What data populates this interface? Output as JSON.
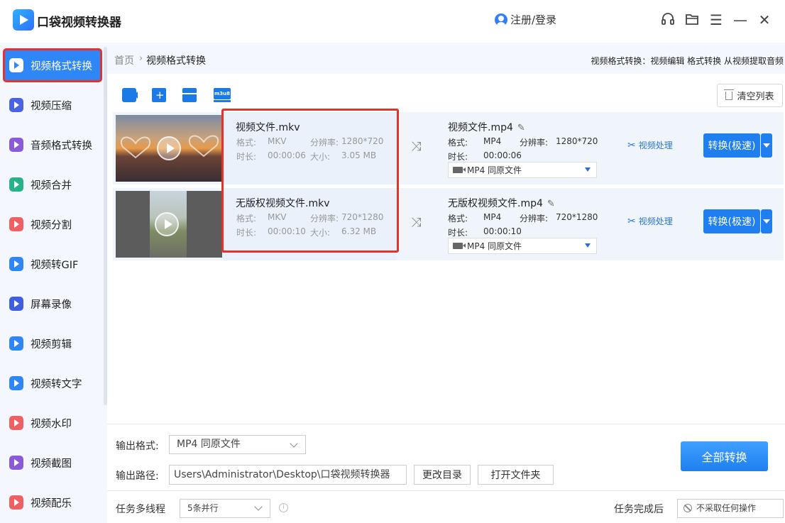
{
  "app": {
    "title": "口袋视频转换器",
    "login": "注册/登录"
  },
  "window": {
    "headset": "headset-icon",
    "folder": "folder-icon",
    "menu": "☰",
    "minimize": "—",
    "close": "✕"
  },
  "sidebar": {
    "items": [
      {
        "label": "视频格式转换",
        "color": "#2f86f6",
        "active": true
      },
      {
        "label": "视频压缩",
        "color": "#4a63e0"
      },
      {
        "label": "音频格式转换",
        "color": "#8a5ad8"
      },
      {
        "label": "视频合并",
        "color": "#27b38a"
      },
      {
        "label": "视频分割",
        "color": "#f06060"
      },
      {
        "label": "视频转GIF",
        "color": "#2f86f6"
      },
      {
        "label": "屏幕录像",
        "color": "#3f5fe0"
      },
      {
        "label": "视频剪辑",
        "color": "#2f86f6"
      },
      {
        "label": "视频转文字",
        "color": "#2f86f6"
      },
      {
        "label": "视频水印",
        "color": "#f06060"
      },
      {
        "label": "视频截图",
        "color": "#8a5ad8"
      },
      {
        "label": "视频配乐",
        "color": "#f06060"
      }
    ]
  },
  "breadcrumb": {
    "home": "首页",
    "current": "视频格式转换",
    "tip": "视频格式转换：视频编辑 格式转换 从视频提取音频"
  },
  "toolbar": {
    "m3u8": "m3u8",
    "clear": "清空列表"
  },
  "files": [
    {
      "src_name": "视频文件.mkv",
      "src_format_label": "格式:",
      "src_format": "MKV",
      "src_res_label": "分辨率:",
      "src_res": "1280*720",
      "src_dur_label": "时长:",
      "src_dur": "00:00:06",
      "src_size_label": "大小:",
      "src_size": "3.05 MB",
      "dst_name": "视频文件.mp4",
      "dst_format_label": "格式:",
      "dst_format": "MP4",
      "dst_res_label": "分辨率:",
      "dst_res": "1280*720",
      "dst_dur_label": "时长:",
      "dst_dur": "00:00:06",
      "dst_select": "MP4  同原文件",
      "process": "视频处理",
      "convert": "转换(极速)"
    },
    {
      "src_name": "无版权视频文件.mkv",
      "src_format_label": "格式:",
      "src_format": "MKV",
      "src_res_label": "分辨率:",
      "src_res": "720*1280",
      "src_dur_label": "时长:",
      "src_dur": "00:00:10",
      "src_size_label": "大小:",
      "src_size": "6.32 MB",
      "dst_name": "无版权视频文件.mp4",
      "dst_format_label": "格式:",
      "dst_format": "MP4",
      "dst_res_label": "分辨率:",
      "dst_res": "720*1280",
      "dst_dur_label": "时长:",
      "dst_dur": "00:00:10",
      "dst_select": "MP4  同原文件",
      "process": "视频处理",
      "convert": "转换(极速)"
    }
  ],
  "output": {
    "format_label": "输出格式:",
    "format_value": "MP4  同原文件",
    "path_label": "输出路径:",
    "path_value": "Users\\Administrator\\Desktop\\口袋视频转换器",
    "change_dir": "更改目录",
    "open_folder": "打开文件夹",
    "convert_all": "全部转换"
  },
  "status": {
    "threads_label": "任务多线程",
    "threads_value": "5条并行",
    "after_label": "任务完成后",
    "after_value": "不采取任何操作"
  }
}
